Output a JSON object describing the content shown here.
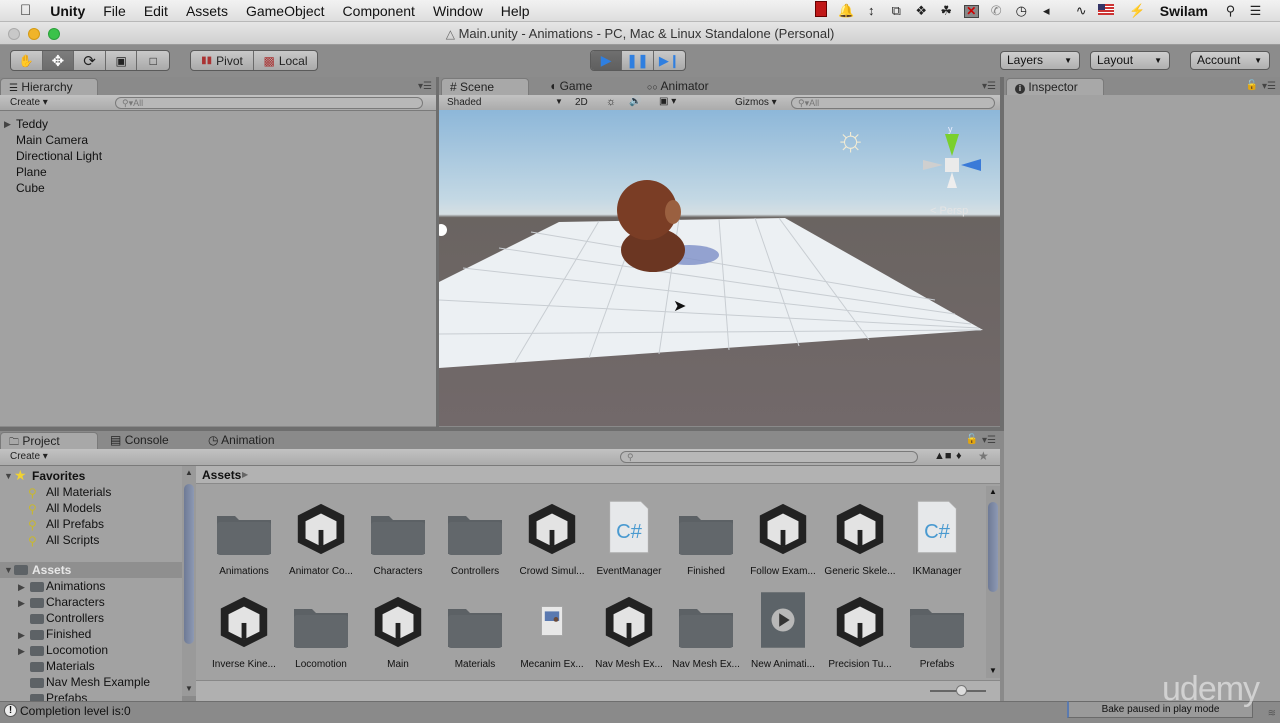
{
  "menubar": {
    "app": "Unity",
    "items": [
      "File",
      "Edit",
      "Assets",
      "GameObject",
      "Component",
      "Window",
      "Help"
    ],
    "status_icons": [
      "flash-video-icon",
      "notification-bell-icon",
      "resize-arrows-icon",
      "screen-share-icon",
      "dropbox-icon",
      "evernote-icon",
      "disabled-display-icon",
      "phone-icon",
      "time-machine-icon",
      "volume-icon",
      "wifi-icon",
      "us-flag-icon",
      "battery-charging-icon"
    ],
    "user": "Swilam"
  },
  "window": {
    "title": "Main.unity - Animations - PC, Mac & Linux Standalone (Personal)"
  },
  "toolbar": {
    "transform_tools": [
      "hand-tool",
      "move-tool",
      "rotate-tool",
      "scale-tool",
      "rect-tool"
    ],
    "active_tool": "move-tool",
    "pivot_label": "Pivot",
    "local_label": "Local",
    "play_state": "playing",
    "layers_label": "Layers",
    "layout_label": "Layout",
    "account_label": "Account"
  },
  "hierarchy": {
    "tab_label": "Hierarchy",
    "create_label": "Create",
    "search_placeholder": "All",
    "items": [
      {
        "label": "Teddy",
        "expandable": true
      },
      {
        "label": "Main Camera",
        "expandable": false
      },
      {
        "label": "Directional Light",
        "expandable": false
      },
      {
        "label": "Plane",
        "expandable": false
      },
      {
        "label": "Cube",
        "expandable": false
      }
    ]
  },
  "scene": {
    "tabs": [
      "Scene",
      "Game",
      "Animator"
    ],
    "active_tab": "Scene",
    "shading_mode": "Shaded",
    "mode_2d_label": "2D",
    "gizmos_label": "Gizmos",
    "search_placeholder": "All",
    "gizmo_axis_label": "y",
    "projection_label": "Persp"
  },
  "inspector": {
    "tab_label": "Inspector"
  },
  "project": {
    "tabs": [
      "Project",
      "Console",
      "Animation"
    ],
    "active_tab": "Project",
    "create_label": "Create",
    "favorites_label": "Favorites",
    "favorites": [
      "All Materials",
      "All Models",
      "All Prefabs",
      "All Scripts"
    ],
    "assets_root_label": "Assets",
    "tree": [
      {
        "label": "Animations",
        "expandable": true
      },
      {
        "label": "Characters",
        "expandable": true
      },
      {
        "label": "Controllers",
        "expandable": false
      },
      {
        "label": "Finished",
        "expandable": true
      },
      {
        "label": "Locomotion",
        "expandable": true
      },
      {
        "label": "Materials",
        "expandable": false
      },
      {
        "label": "Nav Mesh Example",
        "expandable": false
      },
      {
        "label": "Prefabs",
        "expandable": false
      }
    ],
    "breadcrumb": "Assets",
    "assets": [
      {
        "label": "Animations",
        "type": "folder"
      },
      {
        "label": "Animator Co...",
        "type": "unity-scene"
      },
      {
        "label": "Characters",
        "type": "folder"
      },
      {
        "label": "Controllers",
        "type": "folder"
      },
      {
        "label": "Crowd Simul...",
        "type": "unity-scene"
      },
      {
        "label": "EventManager",
        "type": "csharp"
      },
      {
        "label": "Finished",
        "type": "folder"
      },
      {
        "label": "Follow Exam...",
        "type": "unity-scene"
      },
      {
        "label": "Generic Skele...",
        "type": "unity-scene"
      },
      {
        "label": "IKManager",
        "type": "csharp"
      },
      {
        "label": "Inverse Kine...",
        "type": "unity-scene"
      },
      {
        "label": "Locomotion",
        "type": "folder"
      },
      {
        "label": "Main",
        "type": "unity-scene"
      },
      {
        "label": "Materials",
        "type": "folder"
      },
      {
        "label": "Mecanim Ex...",
        "type": "image"
      },
      {
        "label": "Nav Mesh Ex...",
        "type": "unity-scene"
      },
      {
        "label": "Nav Mesh Ex...",
        "type": "folder"
      },
      {
        "label": "New Animati...",
        "type": "animation"
      },
      {
        "label": "Precision Tu...",
        "type": "unity-scene"
      },
      {
        "label": "Prefabs",
        "type": "folder"
      }
    ]
  },
  "status": {
    "message": "Completion level is:0",
    "bake_status": "Bake paused in play mode",
    "watermark": "udemy"
  },
  "colors": {
    "play_blue": "#2f7fe0",
    "menubar_bg": "#e9e9e9",
    "panel_bg": "#a2a2a2",
    "close_red": "#c8c8c8",
    "min_yellow": "#f0b42a",
    "max_green": "#3bc24a"
  }
}
